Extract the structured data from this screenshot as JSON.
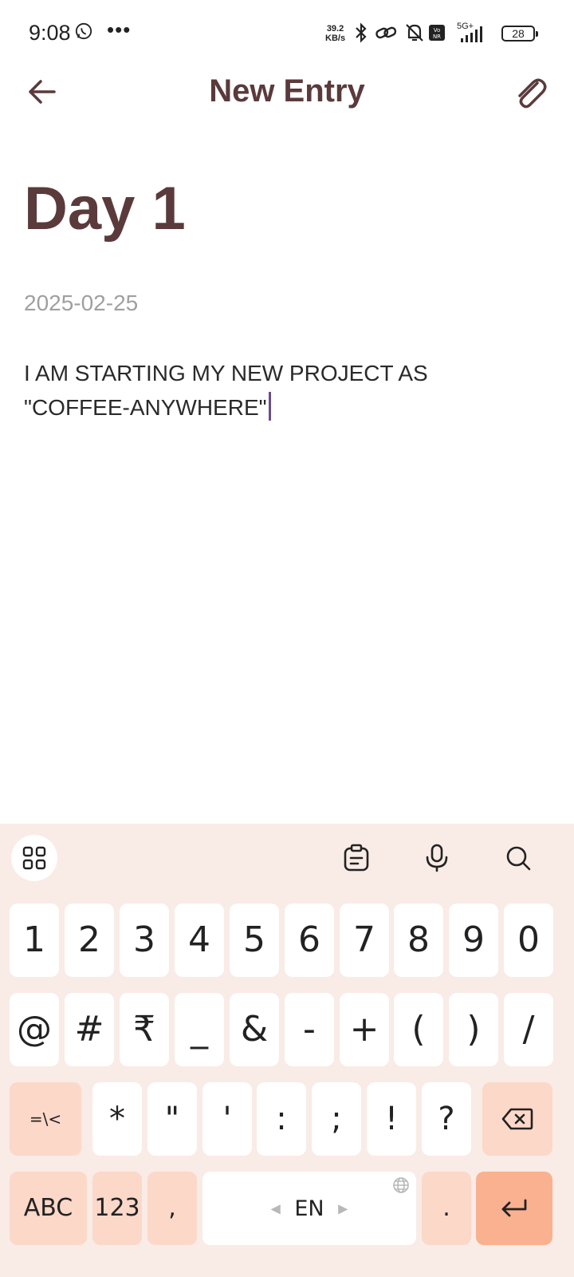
{
  "status_bar": {
    "time": "9:08",
    "more": "•••",
    "net_speed_value": "39.2",
    "net_speed_unit": "KB/s",
    "network": "5G+",
    "battery": "28"
  },
  "app_bar": {
    "title": "New Entry"
  },
  "entry": {
    "title": "Day 1",
    "date": "2025-02-25",
    "body": "I AM STARTING MY NEW PROJECT AS \"COFFEE-ANYWHERE\""
  },
  "keyboard": {
    "row1": [
      "1",
      "2",
      "3",
      "4",
      "5",
      "6",
      "7",
      "8",
      "9",
      "0"
    ],
    "row2": [
      "@",
      "#",
      "₹",
      "_",
      "&",
      "-",
      "+",
      "(",
      ")",
      "/"
    ],
    "row3_symbols_key": "=\\<",
    "row3": [
      "*",
      "\"",
      "'",
      ":",
      ";",
      "!",
      "?"
    ],
    "abc_key": "ABC",
    "num_key": "123",
    "comma_key": ",",
    "space_label": "EN",
    "period_key": "."
  },
  "colors": {
    "accent": "#5b3a3c",
    "keyboard_bg": "#f9ebe6",
    "key_dark": "#fcd8c9",
    "enter_key": "#f9b18f",
    "caret": "#6a4c8c"
  }
}
